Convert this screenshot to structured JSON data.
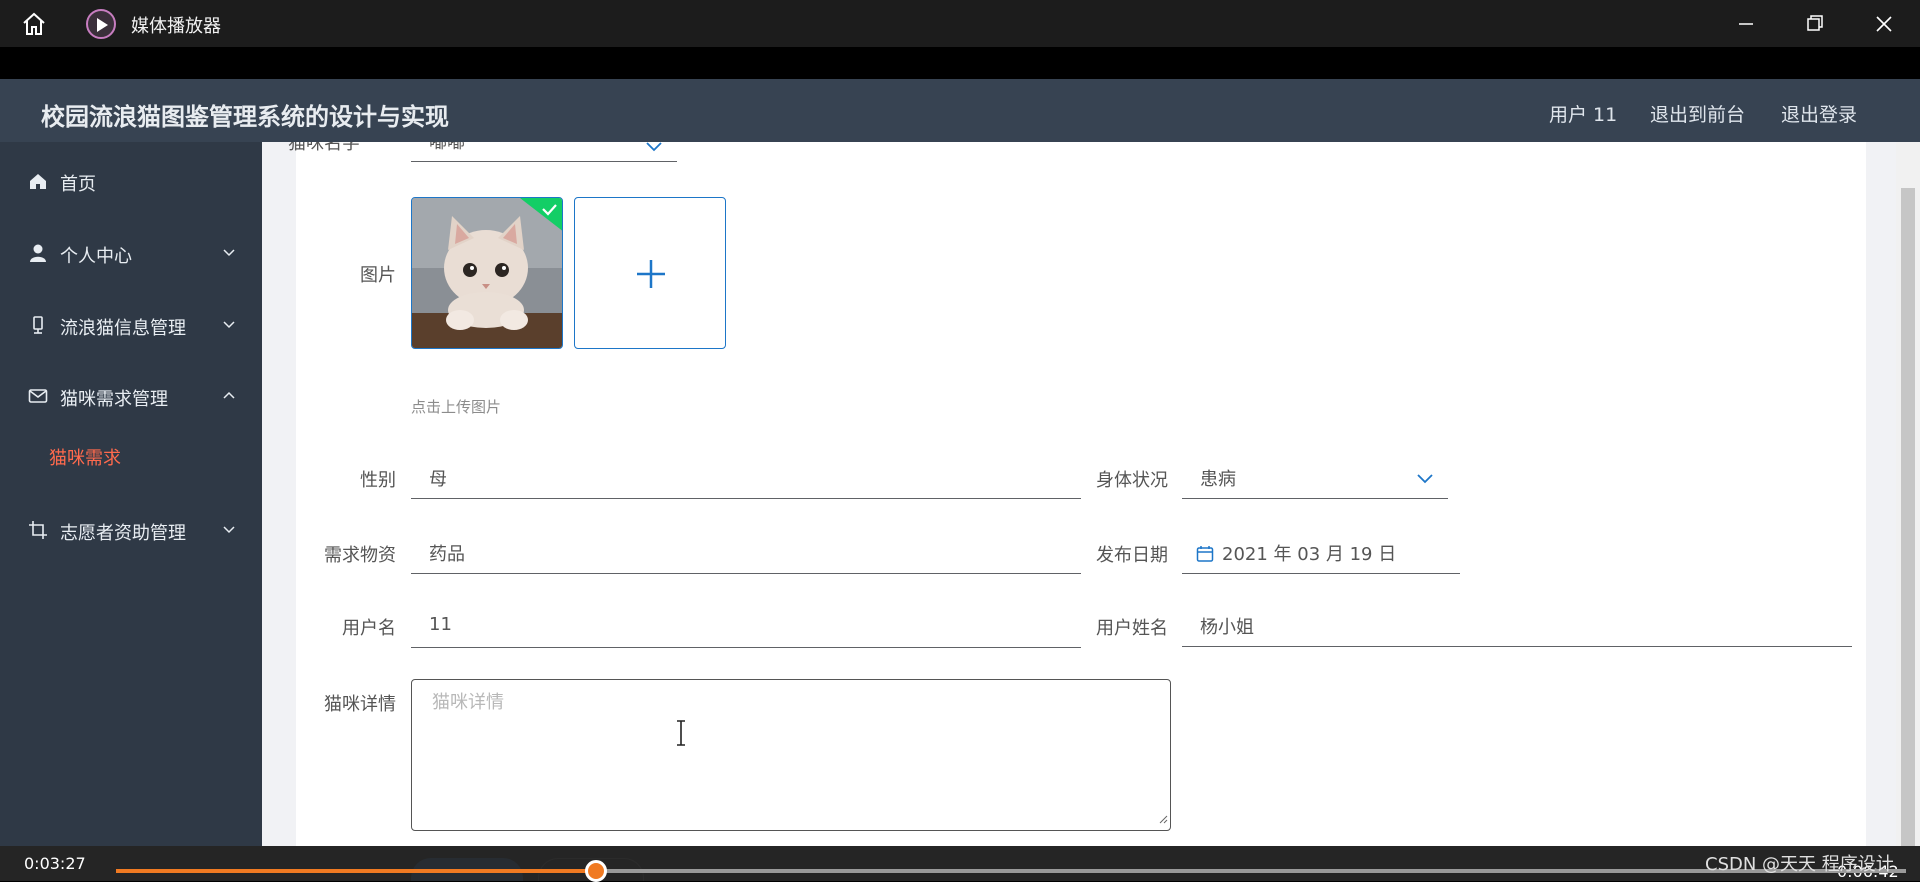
{
  "player": {
    "app_title": "媒体播放器",
    "current_time": "0:03:27",
    "total_time": "0:06:42",
    "progress_fraction": 0.268,
    "accent": "#f07a22"
  },
  "app": {
    "system_title": "校园流浪猫图鉴管理系统的设计与实现",
    "header_links": [
      "用户 11",
      "退出到前台",
      "退出登录"
    ]
  },
  "sidebar": {
    "items": [
      {
        "label": "首页",
        "icon": "home-icon"
      },
      {
        "label": "个人中心",
        "icon": "user-icon",
        "expanded": false
      },
      {
        "label": "流浪猫信息管理",
        "icon": "device-icon",
        "expanded": false
      },
      {
        "label": "猫咪需求管理",
        "icon": "mail-icon",
        "expanded": true
      },
      {
        "label": "志愿者资助管理",
        "icon": "crop-icon",
        "expanded": false
      }
    ],
    "active_subitem": "猫咪需求",
    "active_color": "#ff6a4d"
  },
  "form": {
    "cat_name_label": "猫咪名字",
    "cat_name_value": "嘟嘟",
    "image_label": "图片",
    "upload_hint": "点击上传图片",
    "gender_label": "性别",
    "gender_value": "母",
    "health_label": "身体状况",
    "health_value": "患病",
    "supplies_label": "需求物资",
    "supplies_value": "药品",
    "date_label": "发布日期",
    "date_value": "2021 年 03 月 19 日",
    "username_label": "用户名",
    "username_value": "11",
    "realname_label": "用户姓名",
    "realname_value": "杨小姐",
    "detail_label": "猫咪详情",
    "detail_placeholder": "猫咪详情"
  },
  "watermark": "CSDN @天天 程序设计"
}
